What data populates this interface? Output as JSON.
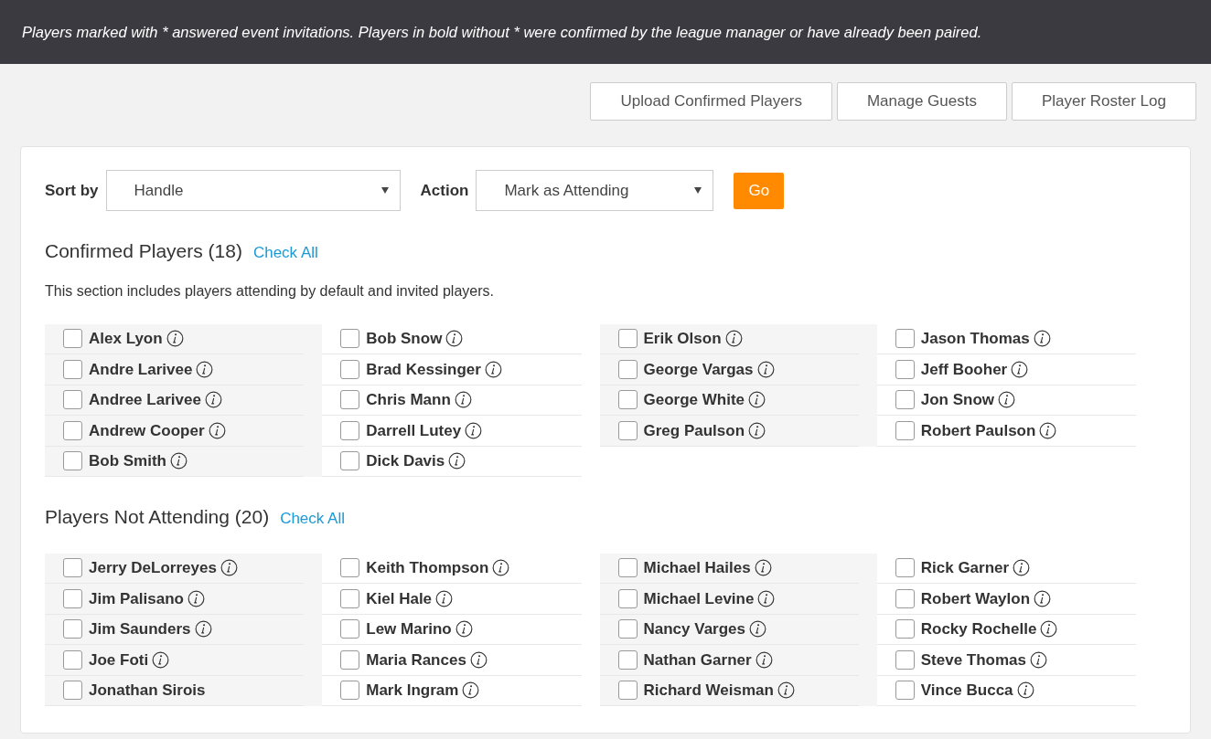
{
  "banner": "Players marked with * answered event invitations. Players in bold without * were confirmed by the league manager or have already been paired.",
  "top_buttons": [
    "Upload Confirmed Players",
    "Manage Guests",
    "Player Roster Log"
  ],
  "sort": {
    "label": "Sort by",
    "value": "Handle"
  },
  "action": {
    "label": "Action",
    "value": "Mark as Attending"
  },
  "go": "Go",
  "sections": [
    {
      "title": "Confirmed Players (18)",
      "check_all": "Check All",
      "note": "This section includes players attending by default and invited players.",
      "columns": [
        [
          {
            "name": "Alex Lyon",
            "checked": false,
            "info": true
          },
          {
            "name": "Andre Larivee",
            "checked": false,
            "info": true
          },
          {
            "name": "Andree Larivee",
            "checked": false,
            "info": true
          },
          {
            "name": "Andrew Cooper",
            "checked": false,
            "info": true
          },
          {
            "name": "Bob Smith",
            "checked": false,
            "info": true
          }
        ],
        [
          {
            "name": "Bob Snow",
            "checked": false,
            "info": true
          },
          {
            "name": "Brad Kessinger",
            "checked": false,
            "info": true
          },
          {
            "name": "Chris Mann",
            "checked": false,
            "info": true
          },
          {
            "name": "Darrell Lutey",
            "checked": false,
            "info": true
          },
          {
            "name": "Dick Davis",
            "checked": false,
            "info": true
          }
        ],
        [
          {
            "name": "Erik Olson",
            "checked": false,
            "info": true
          },
          {
            "name": "George Vargas",
            "checked": false,
            "info": true
          },
          {
            "name": "George White",
            "checked": false,
            "info": true
          },
          {
            "name": "Greg Paulson",
            "checked": false,
            "info": true
          }
        ],
        [
          {
            "name": "Jason Thomas",
            "checked": false,
            "info": true
          },
          {
            "name": "Jeff Booher",
            "checked": false,
            "info": true
          },
          {
            "name": "Jon Snow",
            "checked": false,
            "info": true
          },
          {
            "name": "Robert Paulson",
            "checked": false,
            "info": true
          }
        ]
      ]
    },
    {
      "title": "Players Not Attending (20)",
      "check_all": "Check All",
      "columns": [
        [
          {
            "name": "Jerry DeLorreyes",
            "checked": false,
            "info": true
          },
          {
            "name": "Jim Palisano",
            "checked": false,
            "info": true
          },
          {
            "name": "Jim Saunders",
            "checked": false,
            "info": true
          },
          {
            "name": "Joe Foti",
            "checked": false,
            "info": true
          },
          {
            "name": "Jonathan Sirois",
            "checked": false,
            "info": false
          }
        ],
        [
          {
            "name": "Keith Thompson",
            "checked": false,
            "info": true
          },
          {
            "name": "Kiel Hale",
            "checked": false,
            "info": true
          },
          {
            "name": "Lew Marino",
            "checked": false,
            "info": true
          },
          {
            "name": "Maria Rances",
            "checked": false,
            "info": true
          },
          {
            "name": "Mark Ingram",
            "checked": false,
            "info": true
          }
        ],
        [
          {
            "name": "Michael Hailes",
            "checked": false,
            "info": true
          },
          {
            "name": "Michael Levine",
            "checked": false,
            "info": true
          },
          {
            "name": "Nancy Varges",
            "checked": false,
            "info": true
          },
          {
            "name": "Nathan Garner",
            "checked": false,
            "info": true
          },
          {
            "name": "Richard Weisman",
            "checked": false,
            "info": true
          }
        ],
        [
          {
            "name": "Rick Garner",
            "checked": false,
            "info": true
          },
          {
            "name": "Robert Waylon",
            "checked": false,
            "info": true
          },
          {
            "name": "Rocky Rochelle",
            "checked": false,
            "info": true
          },
          {
            "name": "Steve Thomas",
            "checked": false,
            "info": true
          },
          {
            "name": "Vince Bucca",
            "checked": false,
            "info": true
          }
        ]
      ]
    }
  ]
}
